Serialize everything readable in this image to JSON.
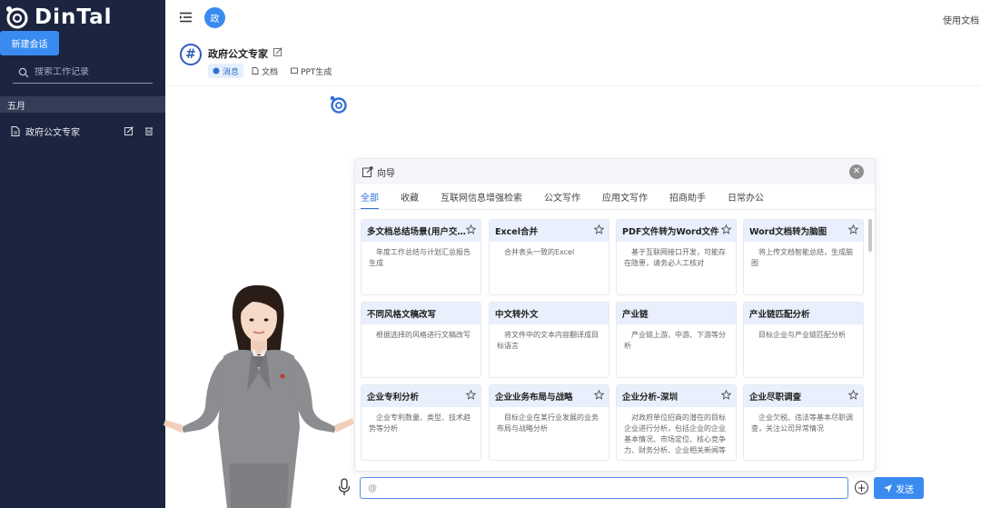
{
  "brand": {
    "name": "DinTal"
  },
  "sidebar": {
    "new_chat_label": "新建会话",
    "search_placeholder": "搜索工作记录",
    "month_label": "五月",
    "history": [
      {
        "label": "政府公文专家"
      }
    ]
  },
  "topbar": {
    "avatar_text": "政",
    "doc_link": "使用文档"
  },
  "agent": {
    "title": "政府公文专家",
    "tabs": [
      {
        "label": "消息",
        "active": true
      },
      {
        "label": "文档",
        "active": false
      },
      {
        "label": "PPT生成",
        "active": false
      }
    ]
  },
  "wizard": {
    "title": "向导",
    "tabs": [
      "全部",
      "收藏",
      "互联网信息增强检索",
      "公文写作",
      "应用文写作",
      "招商助手",
      "日常办公"
    ],
    "active_tab": "全部",
    "cards": [
      {
        "title": "多文档总结场景(用户交...",
        "desc": "年度工作总结与计划汇总报告生成"
      },
      {
        "title": "Excel合并",
        "desc": "合并表头一致的Excel"
      },
      {
        "title": "PDF文件转为Word文件",
        "desc": "基于互联网接口开发，可能存在隐患，请务必人工核对"
      },
      {
        "title": "Word文档转为脑图",
        "desc": "将上传文档智能总结，生成脑图"
      },
      {
        "title": "不同风格文稿改写",
        "desc": "根据选择的风格进行文稿改写"
      },
      {
        "title": "中文转外文",
        "desc": "将文件中的文本内容翻译成目标语言"
      },
      {
        "title": "产业链",
        "desc": "产业链上游、中游、下游等分析"
      },
      {
        "title": "产业链匹配分析",
        "desc": "目标企业与产业链匹配分析"
      },
      {
        "title": "企业专利分析",
        "desc": "企业专利数量、类型、技术趋势等分析"
      },
      {
        "title": "企业业务布局与战略",
        "desc": "目标企业在某行业发展的业务布局与战略分析"
      },
      {
        "title": "企业分析-深圳",
        "desc": "对政府单位招商的潜在的目标企业进行分析，包括企业的企业基本情况、市场定位、核心竞争力、财务分析、企业相关新闻等"
      },
      {
        "title": "企业尽职调查",
        "desc": "企业欠税、违法等基本尽职调查，关注公司异常情况"
      }
    ]
  },
  "composer": {
    "input_placeholder": "@",
    "send_label": "发送"
  },
  "colors": {
    "sidebar_bg": "#1c2540",
    "accent": "#3a8bf0",
    "card_header": "#e9effc"
  }
}
